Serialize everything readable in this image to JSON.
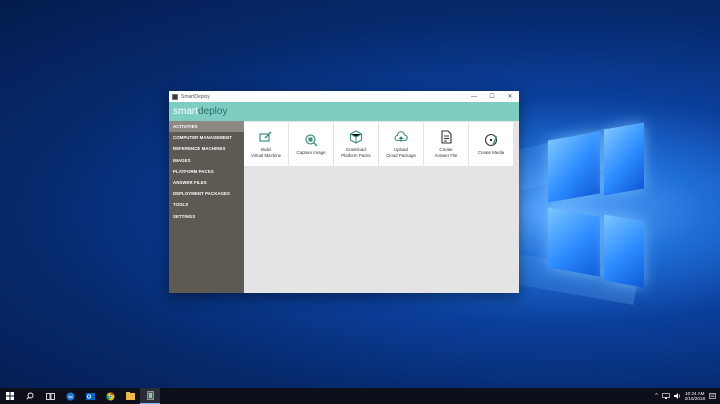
{
  "window": {
    "title": "SmartDeploy",
    "brand_part1": "smart",
    "brand_part2": "deploy",
    "controls": {
      "minimize": "—",
      "maximize": "☐",
      "close": "✕"
    }
  },
  "sidebar": {
    "items": [
      {
        "label": "ACTIVITIES",
        "active": true
      },
      {
        "label": "COMPUTER MANAGEMENT"
      },
      {
        "label": "REFERENCE MACHINES"
      },
      {
        "label": "IMAGES"
      },
      {
        "label": "PLATFORM PACKS"
      },
      {
        "label": "ANSWER FILES"
      },
      {
        "label": "DEPLOYMENT PACKAGES"
      },
      {
        "label": "TOOLS"
      },
      {
        "label": "SETTINGS"
      }
    ]
  },
  "tiles": [
    {
      "label": "Build\nVirtual Machine",
      "icon": "build-vm-icon"
    },
    {
      "label": "Capture Image",
      "icon": "capture-image-icon"
    },
    {
      "label": "Download\nPlatform Packs",
      "icon": "download-platform-icon"
    },
    {
      "label": "Upload\nCloud Package",
      "icon": "cloud-upload-icon"
    },
    {
      "label": "Create\nAnswer File",
      "icon": "answer-file-icon"
    },
    {
      "label": "Create Media",
      "icon": "create-media-icon"
    }
  ],
  "colors": {
    "accent": "#7ecdc1",
    "sidebar": "#5f5954",
    "sidebar_active": "#8d8884",
    "icon": "#3f8f85"
  },
  "taskbar": {
    "clock_time": "10:24 AM",
    "clock_date": "2/15/2018",
    "apps": [
      "start-icon",
      "search-icon",
      "task-view-icon",
      "edge-icon",
      "outlook-icon",
      "chrome-icon",
      "file-explorer-icon",
      "smartdeploy-icon"
    ]
  }
}
